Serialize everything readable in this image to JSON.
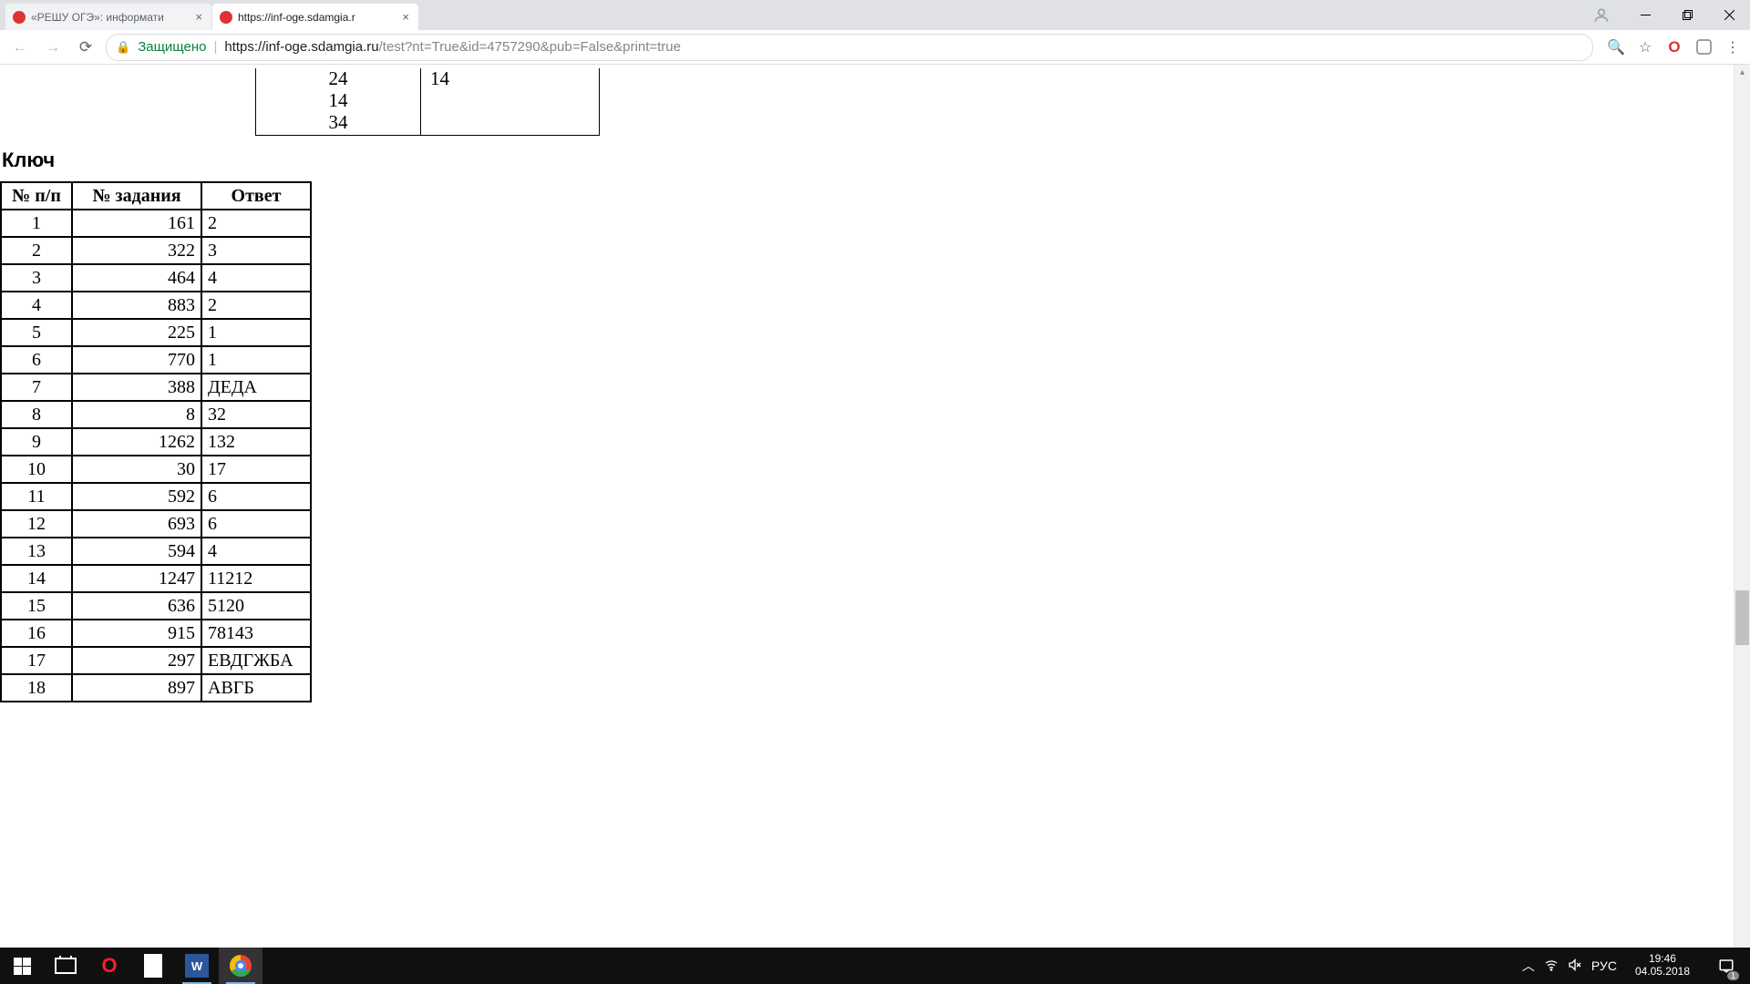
{
  "tabs": [
    {
      "title": "«РЕШУ ОГЭ»: информати"
    },
    {
      "title": "https://inf-oge.sdamgia.r"
    }
  ],
  "omnibox": {
    "secure_label": "Защищено",
    "url_host": "https://inf-oge.sdamgia.ru",
    "url_path": "/test?nt=True&id=4757290&pub=False&print=true"
  },
  "fragment": {
    "left_lines": "24\n14\n34",
    "right": "14"
  },
  "key_title": "Ключ",
  "table": {
    "headers": [
      "№ п/п",
      "№ задания",
      "Ответ"
    ],
    "rows": [
      {
        "n": "1",
        "task": "161",
        "ans": "2"
      },
      {
        "n": "2",
        "task": "322",
        "ans": "3"
      },
      {
        "n": "3",
        "task": "464",
        "ans": "4"
      },
      {
        "n": "4",
        "task": "883",
        "ans": "2"
      },
      {
        "n": "5",
        "task": "225",
        "ans": "1"
      },
      {
        "n": "6",
        "task": "770",
        "ans": "1"
      },
      {
        "n": "7",
        "task": "388",
        "ans": "ДЕДА"
      },
      {
        "n": "8",
        "task": "8",
        "ans": "32"
      },
      {
        "n": "9",
        "task": "1262",
        "ans": "132"
      },
      {
        "n": "10",
        "task": "30",
        "ans": "17"
      },
      {
        "n": "11",
        "task": "592",
        "ans": "6"
      },
      {
        "n": "12",
        "task": "693",
        "ans": "6"
      },
      {
        "n": "13",
        "task": "594",
        "ans": "4"
      },
      {
        "n": "14",
        "task": "1247",
        "ans": "11212"
      },
      {
        "n": "15",
        "task": "636",
        "ans": "5120"
      },
      {
        "n": "16",
        "task": "915",
        "ans": "78143"
      },
      {
        "n": "17",
        "task": "297",
        "ans": "ЕВДГЖБА"
      },
      {
        "n": "18",
        "task": "897",
        "ans": "АВГБ"
      }
    ]
  },
  "taskbar": {
    "lang": "РУС",
    "time": "19:46",
    "date": "04.05.2018",
    "notif_count": "1"
  }
}
